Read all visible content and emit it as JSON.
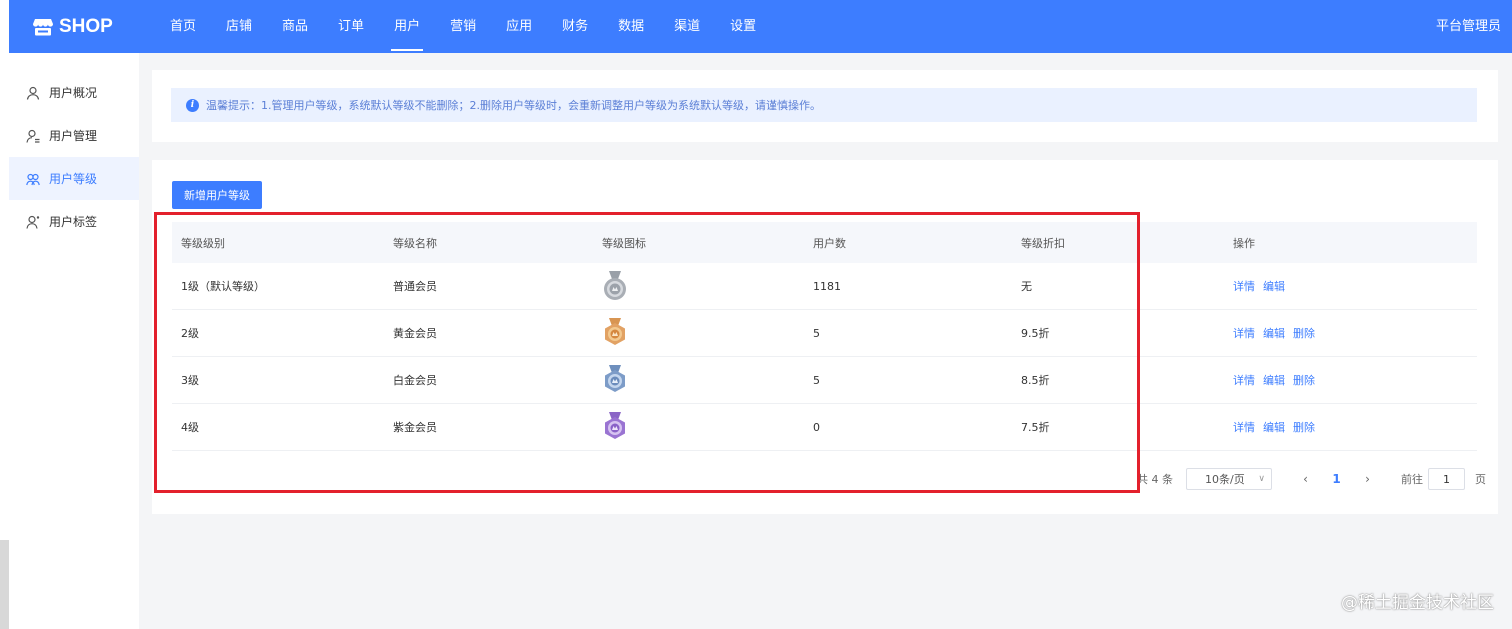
{
  "app": {
    "logo_text": "SHOP",
    "admin_label": "平台管理员"
  },
  "nav": [
    {
      "label": "首页",
      "active": false
    },
    {
      "label": "店铺",
      "active": false
    },
    {
      "label": "商品",
      "active": false
    },
    {
      "label": "订单",
      "active": false
    },
    {
      "label": "用户",
      "active": true
    },
    {
      "label": "营销",
      "active": false
    },
    {
      "label": "应用",
      "active": false
    },
    {
      "label": "财务",
      "active": false
    },
    {
      "label": "数据",
      "active": false
    },
    {
      "label": "渠道",
      "active": false
    },
    {
      "label": "设置",
      "active": false
    }
  ],
  "sidebar": {
    "items": [
      {
        "label": "用户概况",
        "icon": "user-icon",
        "active": false
      },
      {
        "label": "用户管理",
        "icon": "user-manage-icon",
        "active": false
      },
      {
        "label": "用户等级",
        "icon": "user-group-icon",
        "active": true
      },
      {
        "label": "用户标签",
        "icon": "user-tag-icon",
        "active": false
      }
    ]
  },
  "tip": {
    "icon": "info-icon",
    "text": "温馨提示：1.管理用户等级，系统默认等级不能删除；2.删除用户等级时，会重新调整用户等级为系统默认等级，请谨慎操作。"
  },
  "toolbar": {
    "add_label": "新增用户等级"
  },
  "table": {
    "headers": [
      "等级级别",
      "等级名称",
      "等级图标",
      "用户数",
      "等级折扣",
      "操作"
    ],
    "rows": [
      {
        "level": "1级（默认等级）",
        "name": "普通会员",
        "icon": "medal-silver-icon",
        "users": "1181",
        "discount": "无",
        "actions": [
          "详情",
          "编辑"
        ]
      },
      {
        "level": "2级",
        "name": "黄金会员",
        "icon": "medal-gold-icon",
        "users": "5",
        "discount": "9.5折",
        "actions": [
          "详情",
          "编辑",
          "删除"
        ]
      },
      {
        "level": "3级",
        "name": "白金会员",
        "icon": "medal-platinum-icon",
        "users": "5",
        "discount": "8.5折",
        "actions": [
          "详情",
          "编辑",
          "删除"
        ]
      },
      {
        "level": "4级",
        "name": "紫金会员",
        "icon": "medal-purple-icon",
        "users": "0",
        "discount": "7.5折",
        "actions": [
          "详情",
          "编辑",
          "删除"
        ]
      }
    ]
  },
  "pagination": {
    "total": "共 4 条",
    "page_size": "10条/页",
    "current_page": "1",
    "goto_label": "前往",
    "goto_value": "1",
    "goto_suffix": "页",
    "prev_icon": "chevron-left-icon",
    "next_icon": "chevron-right-icon"
  },
  "watermark": "@稀土掘金技术社区",
  "colors": {
    "primary": "#3d7dff",
    "highlight": "#e3202c",
    "tip_bg": "#eaf1ff"
  }
}
